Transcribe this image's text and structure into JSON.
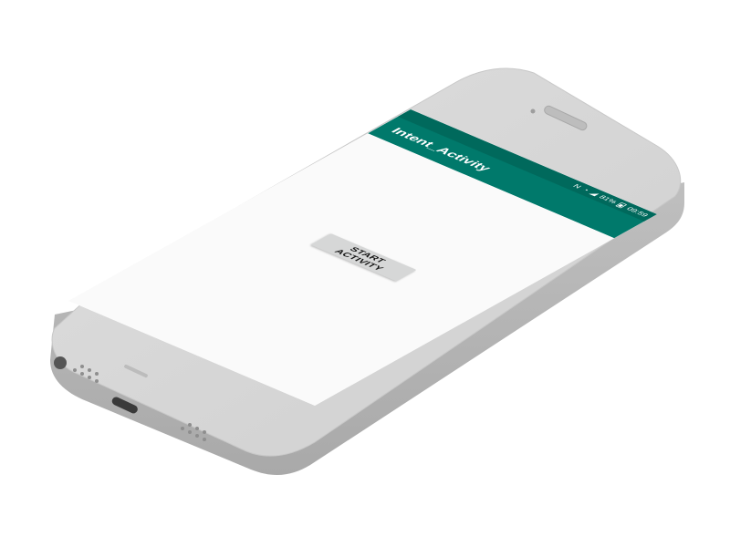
{
  "app": {
    "title": "Intent_Activity"
  },
  "status_bar": {
    "time": "09:59",
    "battery": "81%",
    "icons": [
      "nfc-icon",
      "wifi-icon",
      "signal-icon",
      "battery-icon"
    ]
  },
  "main": {
    "start_button_label": "START ACTIVITY"
  },
  "colors": {
    "app_bar": "#00796b",
    "status_bar": "#00695c",
    "content_background": "#fafafa",
    "button": "#d6d7d7",
    "phone_body": "#d9d9d9"
  }
}
